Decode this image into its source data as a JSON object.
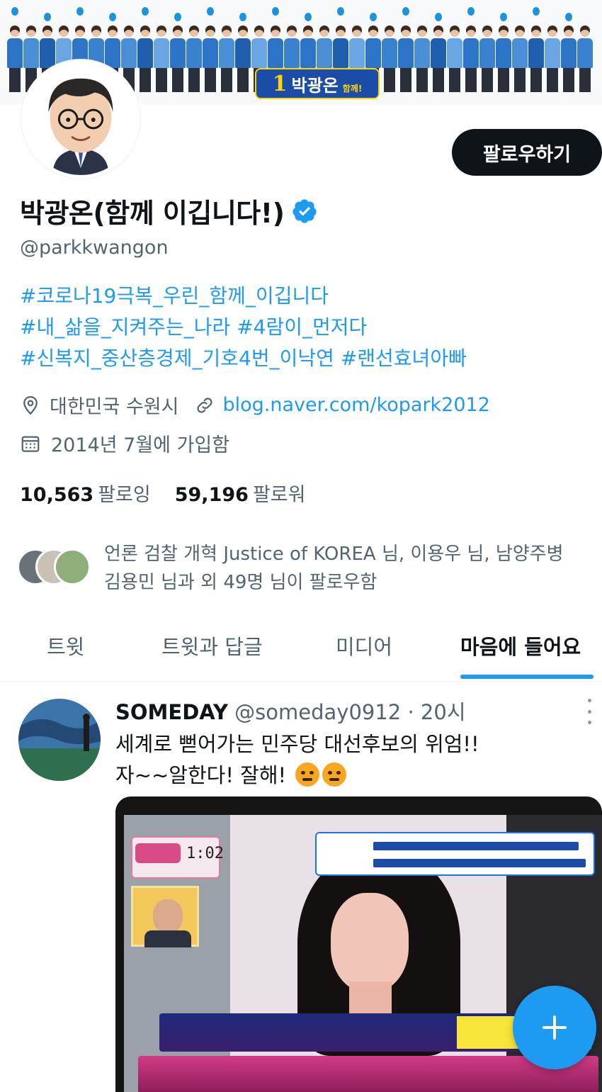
{
  "banner": {
    "logo_number": "1",
    "logo_text": "박광온",
    "logo_sub": "함께!"
  },
  "profile": {
    "follow_button": "팔로우하기",
    "display_name": "박광온(함께 이깁니다!)",
    "handle": "@parkkwangon",
    "bio_lines": [
      "#코로나19극복_우린_함께_이깁니다",
      "#내_삶을_지켜주는_나라 #4람이_먼저다",
      "#신복지_중산층경제_기호4번_이낙연 #랜선효녀아빠"
    ],
    "location": "대한민국 수원시",
    "website": "blog.naver.com/kopark2012",
    "joined": "2014년 7월에 가입함",
    "following_count": "10,563",
    "following_label": "팔로잉",
    "followers_count": "59,196",
    "followers_label": "팔로워",
    "followed_by": [
      "언론 검찰 개혁 Justice of KOREA 님, 이용우 님, 남양주병",
      "김용민 님과 외 49명 님이 팔로우함"
    ]
  },
  "tabs": [
    {
      "label": "트윗",
      "active": false
    },
    {
      "label": "트윗과 답글",
      "active": false
    },
    {
      "label": "미디어",
      "active": false
    },
    {
      "label": "마음에 들어요",
      "active": true
    }
  ],
  "tweet": {
    "author": "SOMEDAY",
    "handle": "@someday0912",
    "separator": "·",
    "time": "20시",
    "text_line1": "세계로 뻗어가는 민주당 대선후보의 위엄!!",
    "text_line2": "자~~알한다!  잘해!",
    "emojis": [
      "angry-face",
      "angry-face"
    ],
    "media": {
      "timer": "1:02"
    }
  },
  "fab": {
    "icon": "plus-icon"
  },
  "colors": {
    "accent": "#1d9bf0",
    "text_primary": "#0f1419",
    "text_secondary": "#536471",
    "follow_button_bg": "#0f1419"
  }
}
